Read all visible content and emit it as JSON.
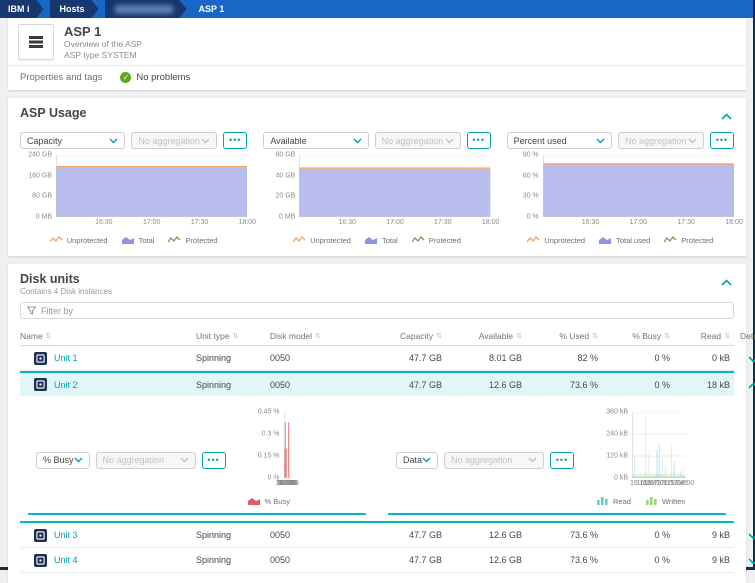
{
  "breadcrumb": {
    "items": [
      {
        "label": "IBM i",
        "redacted": false
      },
      {
        "label": "Hosts",
        "redacted": false
      },
      {
        "label": "",
        "redacted": true
      },
      {
        "label": "ASP 1",
        "redacted": false
      }
    ]
  },
  "header": {
    "title": "ASP 1",
    "subtitle": "Overview of the ASP",
    "type_label": "ASP type",
    "type_value": "SYSTEM"
  },
  "tabs": {
    "properties_label": "Properties and tags",
    "status": "No problems"
  },
  "asp_usage": {
    "title": "ASP Usage"
  },
  "disk_units": {
    "title": "Disk units",
    "subtitle": "Contains 4 Disk instances",
    "filter_placeholder": "Filter by",
    "columns": [
      {
        "label": "Name",
        "sortable": true,
        "align": "left"
      },
      {
        "label": "Unit type",
        "sortable": true,
        "align": "left"
      },
      {
        "label": "Disk model",
        "sortable": true,
        "align": "left"
      },
      {
        "label": "Capacity",
        "sortable": true,
        "align": "right"
      },
      {
        "label": "Available",
        "sortable": true,
        "align": "right"
      },
      {
        "label": "% Used",
        "sortable": true,
        "align": "right"
      },
      {
        "label": "% Busy",
        "sortable": true,
        "align": "right"
      },
      {
        "label": "Read",
        "sortable": true,
        "align": "right"
      },
      {
        "label": "Details",
        "sortable": false,
        "align": "center"
      }
    ],
    "rows": [
      {
        "name": "Unit 1",
        "unit_type": "Spinning",
        "disk_model": "0050",
        "capacity": "47.7 GB",
        "available": "8.01 GB",
        "used": "82 %",
        "busy": "0 %",
        "read": "0 kB",
        "expanded": false
      },
      {
        "name": "Unit 2",
        "unit_type": "Spinning",
        "disk_model": "0050",
        "capacity": "47.7 GB",
        "available": "12.6 GB",
        "used": "73.6 %",
        "busy": "0 %",
        "read": "18 kB",
        "expanded": true
      },
      {
        "name": "Unit 3",
        "unit_type": "Spinning",
        "disk_model": "0050",
        "capacity": "47.7 GB",
        "available": "12.6 GB",
        "used": "73.6 %",
        "busy": "0 %",
        "read": "9 kB",
        "expanded": false
      },
      {
        "name": "Unit 4",
        "unit_type": "Spinning",
        "disk_model": "0050",
        "capacity": "47.7 GB",
        "available": "12.6 GB",
        "used": "73.6 %",
        "busy": "0 %",
        "read": "9 kB",
        "expanded": false
      }
    ]
  },
  "controls": {
    "aggregation_label": "No aggregation"
  },
  "colors": {
    "accent_teal": "#00a1b2",
    "highlight_border": "#00b9c4",
    "row_highlight": "#e1f6f9",
    "area_total": "#b9bdee",
    "line_unprotected": "#f2a36b",
    "line_protected": "#6aa84f",
    "busy_fill": "#f2a0a6",
    "busy_stroke": "#ec747d",
    "read_bar": "#5ecdd8",
    "written_bar": "#a0d67c",
    "status_green": "#5fa818",
    "breadcrumb_bar": "#1667c6",
    "breadcrumb_segment": "#16386f"
  },
  "chart_data": [
    {
      "id": "capacity",
      "group": "usage",
      "type": "area",
      "selected_metric": "Capacity",
      "title": "Capacity",
      "ylim": [
        0,
        240
      ],
      "yticks": [
        "240 GB",
        "160 GB",
        "80 GB",
        "0 MB"
      ],
      "xticks": [
        "16:30",
        "17:00",
        "17:30",
        "18:00"
      ],
      "series": [
        {
          "name": "Unprotected",
          "style": "line",
          "color": "#f2a36b",
          "approx_value": 193
        },
        {
          "name": "Total",
          "style": "area",
          "color": "#b9bdee",
          "approx_value": 192
        },
        {
          "name": "Protected",
          "style": "line",
          "color": "#6aa84f",
          "approx_value": 0
        }
      ]
    },
    {
      "id": "available",
      "group": "usage",
      "type": "area",
      "selected_metric": "Available",
      "title": "Available",
      "ylim": [
        0,
        60
      ],
      "yticks": [
        "60 GB",
        "40 GB",
        "20 GB",
        "0 MB"
      ],
      "xticks": [
        "16:30",
        "17:00",
        "17:30",
        "18:00"
      ],
      "series": [
        {
          "name": "Unprotected",
          "style": "line",
          "color": "#f2a36b",
          "approx_value": 46.8
        },
        {
          "name": "Total",
          "style": "area",
          "color": "#b9bdee",
          "approx_value": 46.5
        },
        {
          "name": "Protected",
          "style": "line",
          "color": "#6aa84f",
          "approx_value": 0
        }
      ]
    },
    {
      "id": "percent_used",
      "group": "usage",
      "type": "area",
      "selected_metric": "Percent used",
      "title": "Percent used",
      "ylim": [
        0,
        90
      ],
      "yticks": [
        "90 %",
        "60 %",
        "30 %",
        "0 %"
      ],
      "xticks": [
        "16:30",
        "17:00",
        "17:30",
        "18:00"
      ],
      "series": [
        {
          "name": "Unprotected",
          "style": "line",
          "color": "#f2a36b",
          "approx_value": 76.5
        },
        {
          "name": "Total used",
          "style": "area",
          "color": "#b9bdee",
          "approx_value": 76
        },
        {
          "name": "Protected",
          "style": "line",
          "color": "#6aa84f",
          "approx_value": 0
        }
      ]
    },
    {
      "id": "busy",
      "group": "detail",
      "type": "spikes",
      "selected_metric": "% Busy",
      "title": "% Busy",
      "ylim": [
        0,
        0.45
      ],
      "yticks": [
        "0.45 %",
        "0.3 %",
        "0.15 %",
        "0 %"
      ],
      "xticks": [
        "16:15",
        "16:30",
        "16:45",
        "17:00",
        "17:15",
        "17:30",
        "17:45",
        "18:00"
      ],
      "spike_color": "#f2a0a6",
      "spike_stroke": "#ec747d",
      "legend": [
        {
          "label": "% Busy",
          "icon": "area",
          "color": "#e05c65"
        }
      ],
      "spikes": [
        {
          "x": 0.13,
          "value": 0.2
        },
        {
          "x": 0.21,
          "value": 0.38
        },
        {
          "x": 0.36,
          "value": 0.2
        },
        {
          "x": 0.715,
          "value": 0.38
        },
        {
          "x": 0.75,
          "value": 0.38
        }
      ]
    },
    {
      "id": "data_io",
      "group": "detail",
      "type": "bars",
      "selected_metric": "Data",
      "title": "Data",
      "ylim": [
        0,
        360
      ],
      "yticks": [
        "360 kB",
        "240 kB",
        "120 kB",
        "0 kB"
      ],
      "xticks": [
        "16:15",
        "16:30",
        "16:45",
        "17:00",
        "17:15",
        "17:30",
        "17:45",
        "18:00"
      ],
      "legend": [
        {
          "label": "Read",
          "icon": "bars",
          "color": "#5ecdd8"
        },
        {
          "label": "Written",
          "icon": "bars",
          "color": "#a0d67c"
        }
      ],
      "series": [
        {
          "name": "Read",
          "color": "#5ecdd8",
          "values": [
            8,
            5,
            10,
            120,
            7,
            12,
            6,
            9,
            14,
            8,
            6,
            11,
            7,
            13,
            9,
            6,
            330,
            8,
            12,
            7,
            150,
            9,
            6,
            13,
            8,
            10,
            7,
            12,
            9,
            150,
            160,
            8,
            185,
            190,
            7,
            10,
            100,
            8,
            12,
            6,
            60,
            9,
            13,
            7,
            10,
            8,
            6,
            175,
            9,
            95,
            7,
            90,
            8,
            11,
            6,
            9,
            12,
            7,
            40,
            8,
            10,
            55,
            9,
            6
          ]
        },
        {
          "name": "Written",
          "color": "#a0d67c",
          "values": [
            22,
            18,
            28,
            24,
            15,
            26,
            20,
            30,
            17,
            23,
            27,
            14,
            25,
            19,
            29,
            21,
            16,
            24,
            28,
            18,
            22,
            26,
            15,
            27,
            20,
            24,
            17,
            29,
            22,
            18,
            26,
            21,
            15,
            25,
            28,
            19,
            23,
            16,
            27,
            22,
            18,
            25,
            20,
            28,
            16,
            24,
            21,
            26,
            18,
            23,
            27,
            15,
            25,
            19,
            22,
            28,
            17,
            24,
            20,
            26,
            18,
            23,
            15,
            21
          ]
        }
      ]
    }
  ],
  "usage_legend": [
    {
      "label": "Unprotected",
      "icon": "line",
      "color": "#f2a36b"
    },
    {
      "label": "Total",
      "icon": "area",
      "color": "#8f96e0"
    },
    {
      "label": "Protected",
      "icon": "line",
      "color": "#6aa84f"
    }
  ],
  "usage_legend_pct": [
    {
      "label": "Unprotected",
      "icon": "line",
      "color": "#f2a36b"
    },
    {
      "label": "Total used",
      "icon": "area",
      "color": "#8f96e0"
    },
    {
      "label": "Protected",
      "icon": "line",
      "color": "#6aa84f"
    }
  ]
}
